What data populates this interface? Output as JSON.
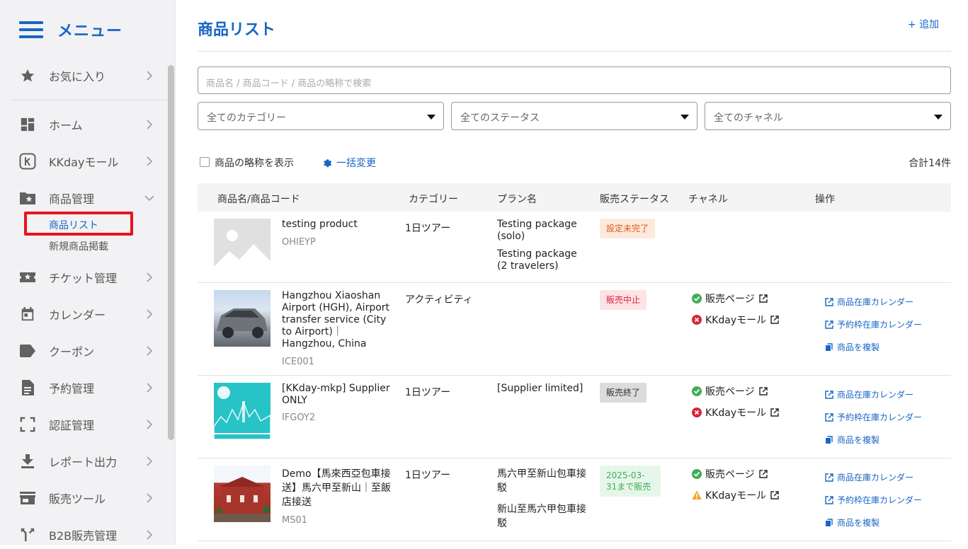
{
  "sidebar": {
    "menu_title": "メニュー",
    "items": [
      {
        "label": "お気に入り",
        "icon": "star-icon"
      },
      {
        "label": "ホーム",
        "icon": "dashboard-icon"
      },
      {
        "label": "KKdayモール",
        "icon": "kkday-icon"
      },
      {
        "label": "商品管理",
        "icon": "folder-star-icon"
      },
      {
        "label": "チケット管理",
        "icon": "ticket-icon"
      },
      {
        "label": "カレンダー",
        "icon": "calendar-icon"
      },
      {
        "label": "クーポン",
        "icon": "tag-icon"
      },
      {
        "label": "予約管理",
        "icon": "document-icon"
      },
      {
        "label": "認証管理",
        "icon": "scan-icon"
      },
      {
        "label": "レポート出力",
        "icon": "download-icon"
      },
      {
        "label": "販売ツール",
        "icon": "store-icon"
      },
      {
        "label": "B2B販売管理",
        "icon": "fork-icon"
      }
    ],
    "sub_items": [
      "商品リスト",
      "新規商品掲載"
    ]
  },
  "main": {
    "title": "商品リスト",
    "add_label": "+ 追加",
    "search_placeholder": "商品名 / 商品コード / 商品の略称で検索",
    "filters": [
      "全てのカテゴリー",
      "全てのステータス",
      "全てのチャネル"
    ],
    "show_abbr_label": "商品の略称を表示",
    "bulk_edit_label": "一括変更",
    "total_label": "合計14件",
    "columns": [
      "商品名/商品コード",
      "カテゴリー",
      "プラン名",
      "販売ステータス",
      "チャネル",
      "操作"
    ],
    "operations": [
      "商品在庫カレンダー",
      "予約枠在庫カレンダー",
      "商品を複製"
    ],
    "rows": [
      {
        "name": "testing product",
        "code": "OHIEYP",
        "category": "1日ツアー",
        "plans": [
          "Testing package (solo)",
          "Testing package (2 travelers)"
        ],
        "status": "設定未完了",
        "channels": []
      },
      {
        "name": "Hangzhou Xiaoshan Airport (HGH), Airport transfer service (City to Airport)｜Hangzhou, China",
        "code": "ICE001",
        "category": "アクティビティ",
        "plans": [],
        "status": "販売中止",
        "channels": [
          {
            "label": "販売ページ",
            "state": "ok"
          },
          {
            "label": "KKdayモール",
            "state": "error"
          }
        ]
      },
      {
        "name": "[KKday-mkp] Supplier ONLY",
        "code": "IFGOY2",
        "category": "1日ツアー",
        "plans": [
          "[Supplier limited]"
        ],
        "status": "販売終了",
        "channels": [
          {
            "label": "販売ページ",
            "state": "ok"
          },
          {
            "label": "KKdayモール",
            "state": "error"
          }
        ]
      },
      {
        "name": "Demo【馬來西亞包車接送】馬六甲至新山｜至飯店接送",
        "code": "MS01",
        "category": "1日ツアー",
        "plans": [
          "馬六甲至新山包車接駁",
          "新山至馬六甲包車接駁"
        ],
        "status": "2025-03-31まで販売",
        "channels": [
          {
            "label": "販売ページ",
            "state": "ok"
          },
          {
            "label": "KKdayモール",
            "state": "warning"
          }
        ]
      }
    ]
  },
  "colors": {
    "brand_blue": "#1866c4",
    "highlight_red": "#e8141b",
    "ok_green": "#3fae57",
    "error_red": "#d9233a",
    "warning_orange": "#f5a623"
  }
}
